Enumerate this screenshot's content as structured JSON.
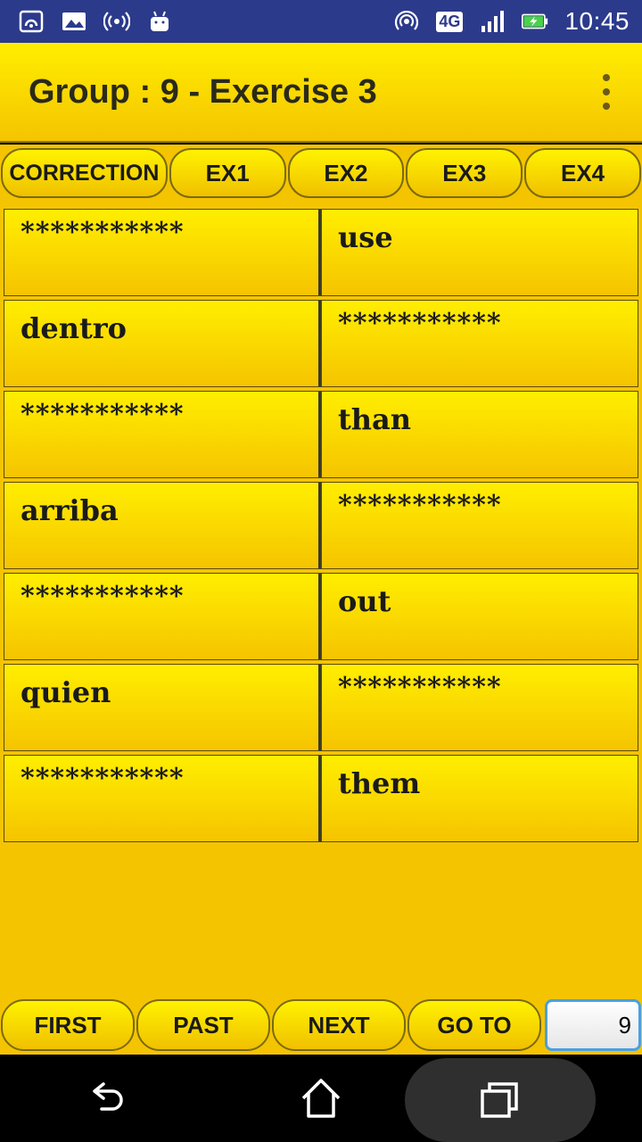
{
  "status_bar": {
    "icons_left": [
      "cast-icon",
      "image-icon",
      "radio-icon",
      "android-icon"
    ],
    "network": "4G",
    "time": "10:45"
  },
  "app_bar": {
    "title": "Group : 9 - Exercise 3",
    "menu_icon": "more-vert-icon"
  },
  "tabs": [
    {
      "label": "CORRECTION"
    },
    {
      "label": "EX1"
    },
    {
      "label": "EX2"
    },
    {
      "label": "EX3"
    },
    {
      "label": "EX4"
    }
  ],
  "rows": [
    {
      "left": "***********",
      "right": "use"
    },
    {
      "left": "dentro",
      "right": "***********"
    },
    {
      "left": "***********",
      "right": "than"
    },
    {
      "left": "arriba",
      "right": "***********"
    },
    {
      "left": "***********",
      "right": "out"
    },
    {
      "left": "quien",
      "right": "***********"
    },
    {
      "left": "***********",
      "right": "them"
    }
  ],
  "bottom_bar": {
    "first": "FIRST",
    "past": "PAST",
    "next": "NEXT",
    "goto": "GO TO",
    "goto_value": "9"
  },
  "colors": {
    "status_bar": "#2c3a8c",
    "yellow_top": "#ffee00",
    "yellow_bottom": "#f5c400",
    "input_border": "#4aa0e0"
  }
}
